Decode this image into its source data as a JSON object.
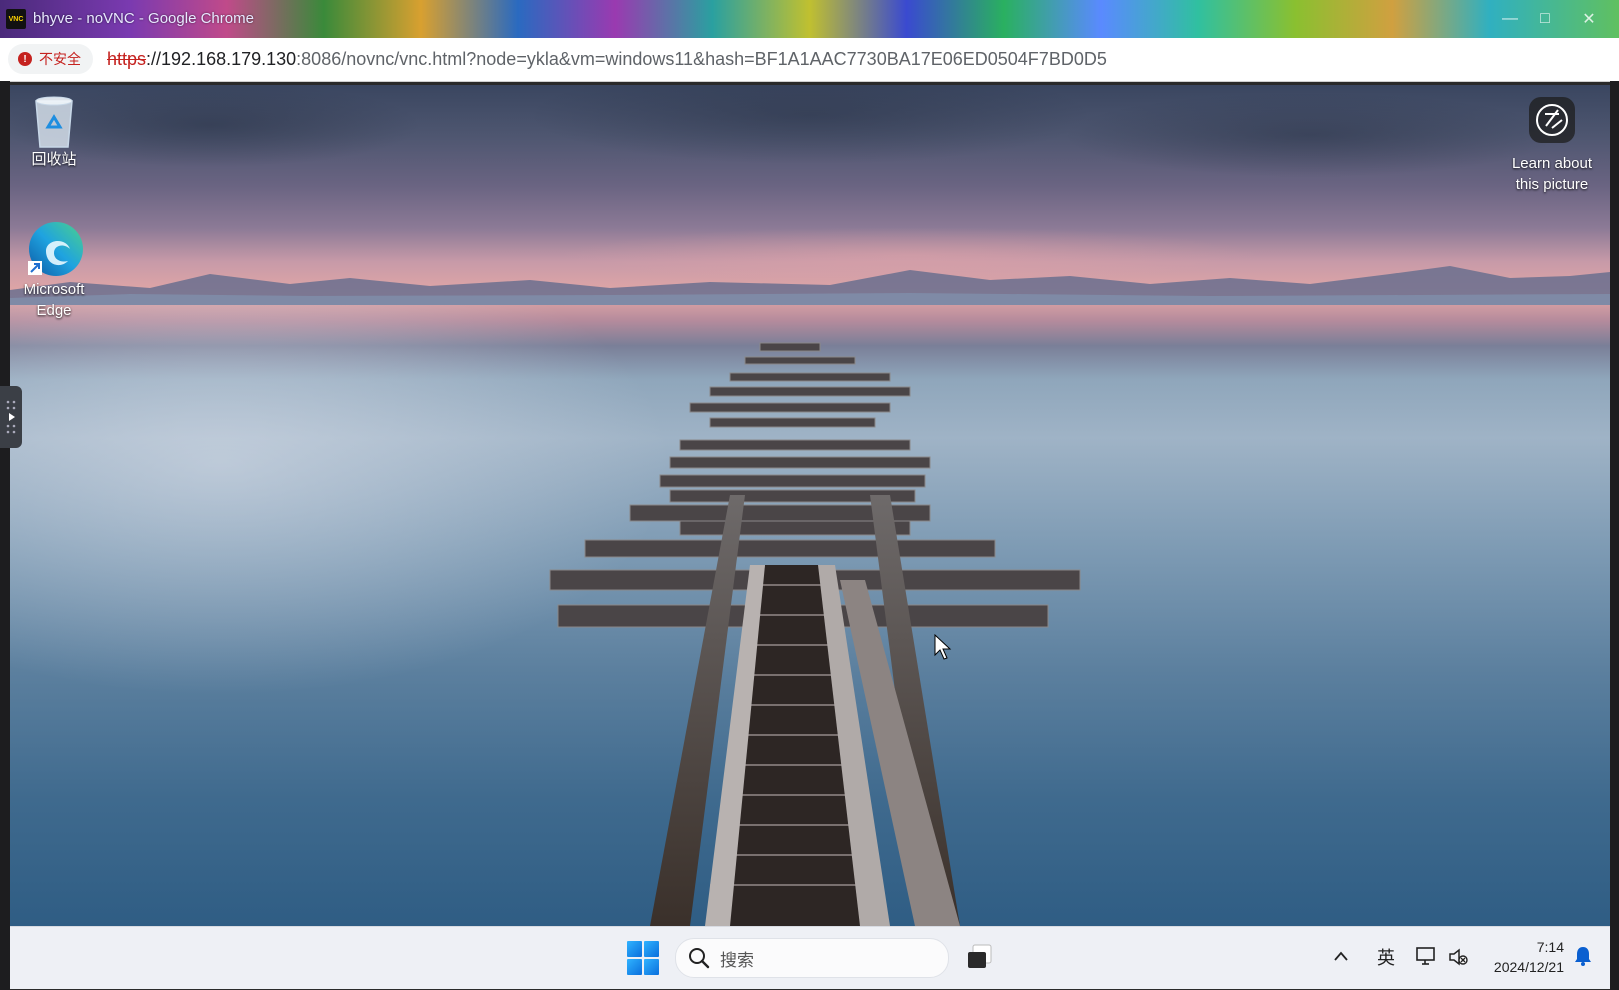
{
  "browser": {
    "tab_title": "bhyve - noVNC - Google Chrome",
    "vnc_logo_text": "VNC",
    "security_label": "不安全",
    "url_scheme": "https",
    "url_host": "://192.168.179.130",
    "url_rest": ":8086/novnc/vnc.html?node=ykla&vm=windows11&hash=BF1A1AAC7730BA17E06ED0504F7BD0D5"
  },
  "desktop": {
    "icons": [
      {
        "label": "回收站",
        "icon": "recycle-bin-icon"
      },
      {
        "label_line1": "Microsoft",
        "label_line2": "Edge",
        "icon": "edge-icon"
      }
    ],
    "learn_about": {
      "line1": "Learn about",
      "line2": "this picture",
      "icon": "camera-icon"
    }
  },
  "taskbar": {
    "search_placeholder": "搜索",
    "ime_label": "英",
    "time": "7:14",
    "date": "2024/12/21"
  },
  "colors": {
    "taskbar_bg": "#eef0f5",
    "insecure_red": "#c5221f",
    "start_blue": "#0a6fdc"
  }
}
